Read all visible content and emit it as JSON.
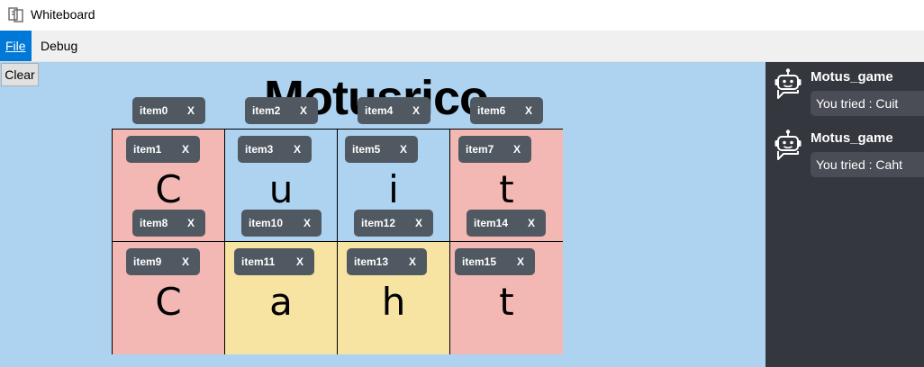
{
  "window": {
    "title": "Whiteboard",
    "icon": "app-logo-icon"
  },
  "menu": {
    "file_label": "File",
    "debug_label": "Debug"
  },
  "board": {
    "clear_label": "Clear",
    "title": "Motusrico",
    "grid": [
      [
        {
          "letter": "C",
          "color": "#f4b8b4"
        },
        {
          "letter": "u",
          "color": "#add3f0"
        },
        {
          "letter": "i",
          "color": "#add3f0"
        },
        {
          "letter": "t",
          "color": "#f4b8b4"
        }
      ],
      [
        {
          "letter": "C",
          "color": "#f4b8b4"
        },
        {
          "letter": "a",
          "color": "#f7e4a2"
        },
        {
          "letter": "h",
          "color": "#f7e4a2"
        },
        {
          "letter": "t",
          "color": "#f4b8b4"
        }
      ]
    ],
    "tags": [
      {
        "label": "item0",
        "close": "X"
      },
      {
        "label": "item1",
        "close": "X"
      },
      {
        "label": "item2",
        "close": "X"
      },
      {
        "label": "item3",
        "close": "X"
      },
      {
        "label": "item4",
        "close": "X"
      },
      {
        "label": "item5",
        "close": "X"
      },
      {
        "label": "item6",
        "close": "X"
      },
      {
        "label": "item7",
        "close": "X"
      },
      {
        "label": "item8",
        "close": "X"
      },
      {
        "label": "item9",
        "close": "X"
      },
      {
        "label": "item10",
        "close": "X"
      },
      {
        "label": "item11",
        "close": "X"
      },
      {
        "label": "item12",
        "close": "X"
      },
      {
        "label": "item13",
        "close": "X"
      },
      {
        "label": "item14",
        "close": "X"
      },
      {
        "label": "item15",
        "close": "X"
      }
    ]
  },
  "chat": {
    "messages": [
      {
        "author": "Motus_game",
        "text": "You tried : Cuit",
        "icon": "robot-icon"
      },
      {
        "author": "Motus_game",
        "text": "You tried : Caht",
        "icon": "robot-icon"
      }
    ]
  },
  "colors": {
    "board_bg": "#add3f0",
    "wrong_place": "#f7e4a2",
    "correct": "#f4b8b4",
    "chat_bg": "#35373f",
    "tag_bg": "#505861",
    "menu_active": "#0078d7"
  }
}
